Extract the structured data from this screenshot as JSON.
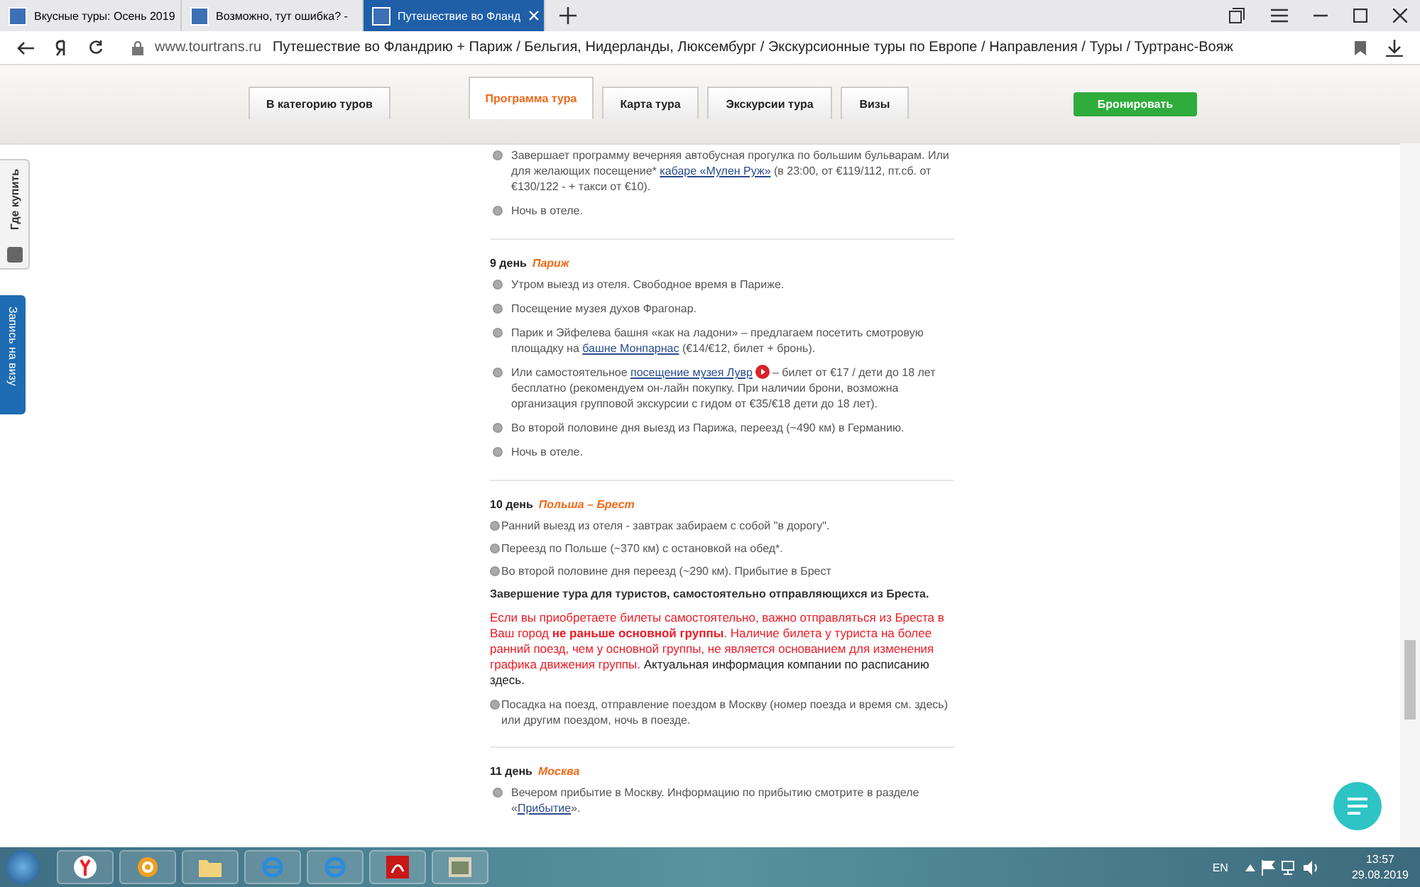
{
  "browser": {
    "tabs": [
      {
        "title": "Вкусные туры: Осень 2019",
        "selected": false
      },
      {
        "title": "Возможно, тут ошибка? -",
        "selected": false
      },
      {
        "title": "Путешествие во Фланд",
        "selected": true
      }
    ],
    "address": {
      "host": "www.tourtrans.ru",
      "title": "Путешествие во Фландрию + Париж / Бельгия, Нидерланды, Люксембург / Экскурсионные туры по Европе / Направления / Туры / Туртранс-Вояж"
    }
  },
  "nav": {
    "tabs": [
      {
        "label": "В категорию туров",
        "selected": false
      },
      {
        "label": "Программа тура",
        "selected": true
      },
      {
        "label": "Карта тура",
        "selected": false
      },
      {
        "label": "Экскурсии тура",
        "selected": false
      },
      {
        "label": "Визы",
        "selected": false
      }
    ],
    "book_button": "Бронировать"
  },
  "side_tabs": [
    "Где купить",
    "Запись на визу"
  ],
  "days": [
    {
      "items": [
        {
          "kind": "bullet",
          "parts": [
            {
              "kind": "text",
              "text": "Завершает программу вечерняя автобусная прогулка по большим бульварам. Или для желающих посещение* "
            },
            {
              "kind": "link",
              "text": "кабаре «Мулен Руж»"
            },
            {
              "kind": "text",
              "text": " (в 23:00, от €119/112, пт.сб. от €130/122 -  + такси от €10)."
            }
          ]
        },
        {
          "kind": "bullet",
          "parts": [
            {
              "kind": "text",
              "text": "Ночь в отеле."
            }
          ]
        }
      ]
    },
    {
      "day": "9 день",
      "place": "Париж",
      "items": [
        {
          "kind": "bullet",
          "parts": [
            {
              "kind": "text",
              "text": "Утром выезд из отеля. Свободное время в Париже."
            }
          ]
        },
        {
          "kind": "bullet",
          "parts": [
            {
              "kind": "text",
              "text": "Посещение музея духов Фрагонар."
            }
          ]
        },
        {
          "kind": "bullet",
          "parts": [
            {
              "kind": "text",
              "text": "Парик и Эйфелева башня «как на ладони» – предлагаем посетить смотровую площадку на "
            },
            {
              "kind": "link",
              "text": "башне Монпарнас"
            },
            {
              "kind": "text",
              "text": " (€14/€12, билет + бронь)."
            }
          ]
        },
        {
          "kind": "bullet",
          "parts": [
            {
              "kind": "text",
              "text": "Или самостоятельное "
            },
            {
              "kind": "link",
              "text": "посещение музея Лувр"
            },
            {
              "kind": "play"
            },
            {
              "kind": "text",
              "text": "– билет от €17 / дети до 18 лет бесплатно (рекомендуем он-лайн покупку. При наличии брони, возможна организация групповой экскурсии с гидом от €35/€18 дети до 18 лет)."
            }
          ]
        },
        {
          "kind": "bullet",
          "parts": [
            {
              "kind": "text",
              "text": "Во второй половине дня выезд из Парижа, переезд (~490 км) в Германию."
            }
          ]
        },
        {
          "kind": "bullet",
          "parts": [
            {
              "kind": "text",
              "text": "Ночь в отеле."
            }
          ]
        }
      ]
    },
    {
      "day": "10 день",
      "place": "Польша – Брест",
      "items": [
        {
          "kind": "overlap",
          "parts": [
            {
              "kind": "text",
              "text": "Ранний выезд из отеля - завтрак забираем с собой \"в дорогу\"."
            }
          ]
        },
        {
          "kind": "overlap",
          "parts": [
            {
              "kind": "text",
              "text": "Переезд по Польше (~370 км) с остановкой на обед*."
            }
          ]
        },
        {
          "kind": "overlap",
          "parts": [
            {
              "kind": "text",
              "text": "Во второй половине дня переезд (~290 км). Прибытие в Брест"
            }
          ]
        },
        {
          "kind": "strong",
          "parts": [
            {
              "kind": "text",
              "text": "Завершение тура для туристов, самостоятельно отправляющихся из Бреста."
            }
          ]
        },
        {
          "kind": "warning",
          "parts": [
            {
              "kind": "alert",
              "text": "Если вы приобретаете билеты самостоятельно, важно отправляться из Бреста в Ваш город **не раньше основной группы**. Наличие билета у туриста на более ранний поезд, чем у основной группы, не является основанием для изменения графика движения группы."
            },
            {
              "kind": "text",
              "text": " Актуальная информация компании по расписанию здесь."
            }
          ]
        },
        {
          "kind": "overlap",
          "parts": [
            {
              "kind": "text",
              "text": "Посадка на поезд, отправление поездом в Москву (номер поезда и время см. здесь) или другим поездом, ночь в поезде."
            }
          ]
        }
      ]
    },
    {
      "day": "11 день",
      "place": "Москва",
      "items": [
        {
          "kind": "bullet",
          "parts": [
            {
              "kind": "text",
              "text": "Вечером прибытие в Москву. Информацию по прибытию смотрите в разделе «"
            },
            {
              "kind": "link",
              "text": "Прибытие"
            },
            {
              "kind": "text",
              "text": "»."
            }
          ]
        }
      ]
    }
  ],
  "taskbar": {
    "language": "EN",
    "time": "13:57",
    "date": "29.08.2019"
  }
}
